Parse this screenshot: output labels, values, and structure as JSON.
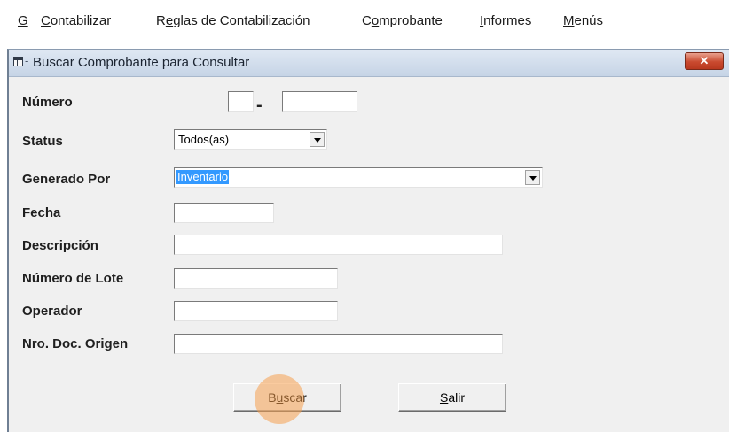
{
  "menubar": {
    "items": [
      {
        "mnemonic": "G",
        "rest": ""
      },
      {
        "mnemonic": "C",
        "rest": "ontabilizar"
      },
      {
        "lead": "R",
        "mnemonic": "e",
        "rest": "glas de Contabilización"
      },
      {
        "lead": "C",
        "mnemonic": "o",
        "rest": "mprobante"
      },
      {
        "mnemonic": "I",
        "rest": "nformes"
      },
      {
        "mnemonic": "M",
        "rest": "enús"
      }
    ]
  },
  "window": {
    "title": "Buscar Comprobante  para Consultar",
    "close_glyph": "✕",
    "icon": "window-icon",
    "close_color": "#c94a2f"
  },
  "form": {
    "numero": {
      "label": "Número",
      "part1": "",
      "part2": "",
      "separator": "-"
    },
    "status": {
      "label": "Status",
      "selected": "Todos(as)"
    },
    "generado_por": {
      "label": "Generado Por",
      "selected": "Inventario",
      "selected_highlight": "#3399ff"
    },
    "fecha": {
      "label": "Fecha",
      "value": ""
    },
    "descripcion": {
      "label": "Descripción",
      "value": ""
    },
    "numero_lote": {
      "label": "Número de Lote",
      "value": ""
    },
    "operador": {
      "label": "Operador",
      "value": ""
    },
    "nro_doc_origen": {
      "label": "Nro. Doc. Origen",
      "value": ""
    }
  },
  "buttons": {
    "buscar": {
      "pre": "B",
      "mnemonic": "u",
      "post": "scar"
    },
    "salir": {
      "pre": "",
      "mnemonic": "S",
      "post": "alir"
    }
  },
  "cursor_highlight_color": "#f5a050"
}
